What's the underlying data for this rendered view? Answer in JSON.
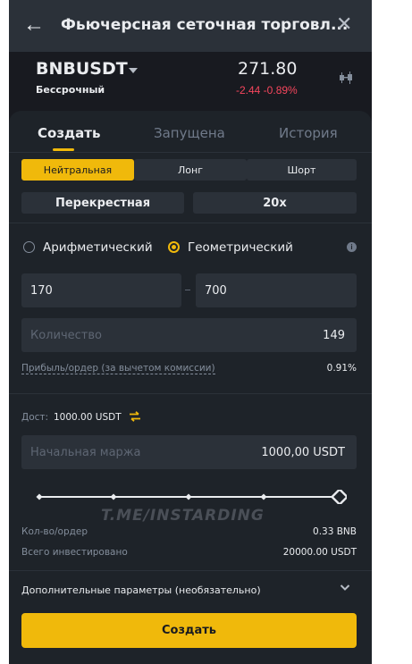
{
  "header": {
    "title": "Фьючерсная сеточная торговл...",
    "back_icon": "arrow-left-icon",
    "close_icon": "close-icon"
  },
  "ticker": {
    "symbol": "BNBUSDT",
    "contract_type": "Бессрочный",
    "price": "271.80",
    "change": "-2.44 -0.89%",
    "change_color": "#f6465d",
    "chart_icon": "candlestick-icon"
  },
  "tabs": [
    {
      "label": "Создать",
      "active": true
    },
    {
      "label": "Запущена",
      "active": false
    },
    {
      "label": "История",
      "active": false
    }
  ],
  "direction": {
    "options": [
      "Нейтральная",
      "Лонг",
      "Шорт"
    ],
    "selected": "Нейтральная"
  },
  "margin_mode": {
    "mode": "Перекрестная",
    "leverage": "20x"
  },
  "grid_type": {
    "arithmetic": "Арифметический",
    "geometric": "Геометрический",
    "selected": "Геометрический",
    "info_icon": "info-icon"
  },
  "price_range": {
    "lower": "170",
    "upper": "700"
  },
  "grid_count": {
    "placeholder": "Количество",
    "value": "149"
  },
  "profit": {
    "label": "Прибыль/ордер (за вычетом комиссии)",
    "value": "0.91%"
  },
  "available": {
    "label": "Дост:",
    "value": "1000.00 USDT",
    "icon": "swap-icon"
  },
  "margin": {
    "placeholder": "Начальная маржа",
    "value": "1000,00 USDT"
  },
  "slider": {
    "level": 1.0
  },
  "watermark": "T.ME/INSTARDING",
  "summary": {
    "qty_label": "Кол-во/ордер",
    "qty_value": "0.33 BNB",
    "total_label": "Всего инвестировано",
    "total_value": "20000.00 USDT"
  },
  "advanced": {
    "label": "Дополнительные параметры (необязательно)",
    "icon": "chevron-down-icon"
  },
  "submit": {
    "label": "Создать"
  },
  "colors": {
    "accent": "#f0b90b",
    "background": "#181a20",
    "panel": "#1e2329",
    "field": "#2b3139"
  }
}
